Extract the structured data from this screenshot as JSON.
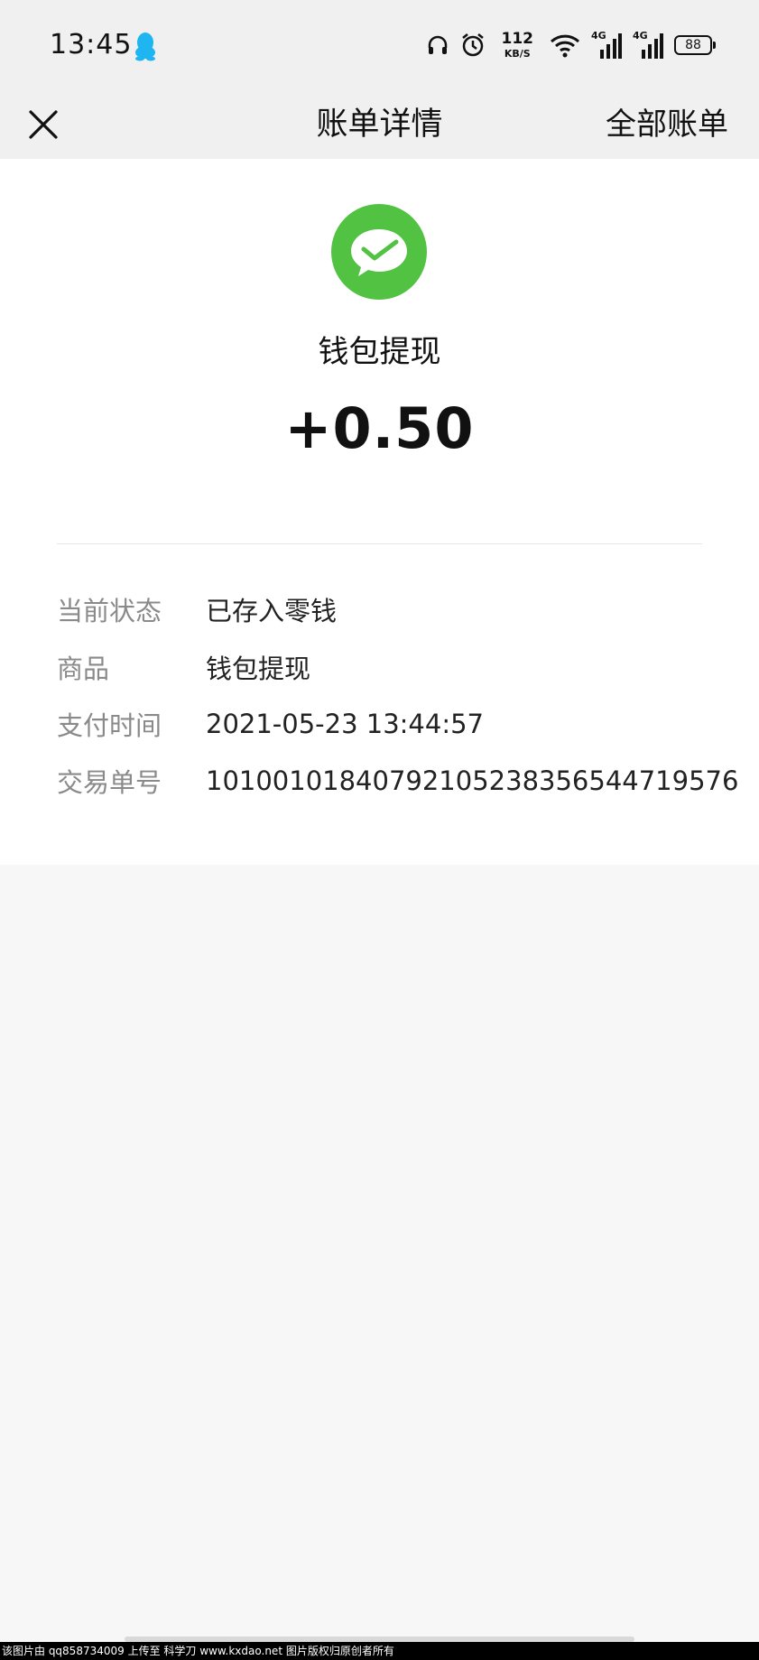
{
  "status_bar": {
    "time": "13:45",
    "net_speed_value": "112",
    "net_speed_unit": "KB/S",
    "signal1_label": "4G",
    "signal2_label": "4G",
    "battery": "88",
    "icons": [
      "qq-penguin-icon",
      "headset-icon",
      "alarm-clock-icon",
      "wifi-icon",
      "signal-icon",
      "signal-icon",
      "battery-icon"
    ]
  },
  "nav": {
    "title": "账单详情",
    "action_label": "全部账单",
    "close_icon": "close-icon"
  },
  "transaction": {
    "logo_icon": "wechat-pay-icon",
    "logo_color": "#52c242",
    "title": "钱包提现",
    "amount": "+0.50"
  },
  "details": [
    {
      "label": "当前状态",
      "value": "已存入零钱"
    },
    {
      "label": "商品",
      "value": "钱包提现"
    },
    {
      "label": "支付时间",
      "value": "2021-05-23 13:44:57"
    },
    {
      "label": "交易单号",
      "value": "101001018407921052383565447195​76"
    }
  ],
  "watermark": "该图片由 qq858734009 上传至 科学刀 www.kxdao.net 图片版权归原创者所有"
}
